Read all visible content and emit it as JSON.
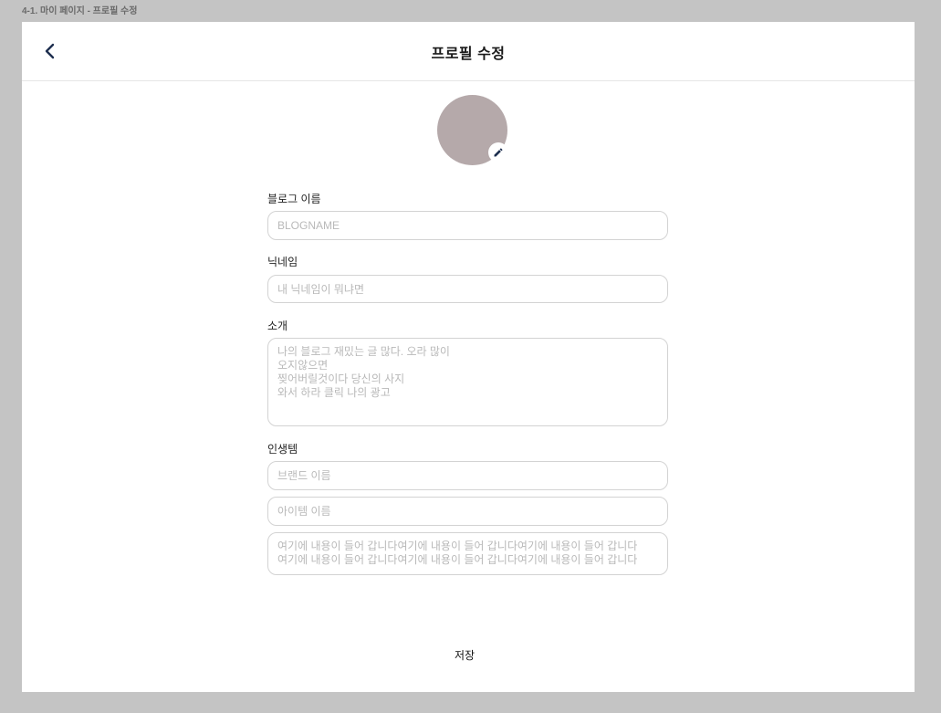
{
  "frame_label": "4-1. 마이 페이지 - 프로필 수정",
  "header": {
    "title": "프로필 수정",
    "back_icon": "chevron-left-icon"
  },
  "avatar": {
    "color": "#b5a9aa",
    "edit_icon": "pencil-icon"
  },
  "form": {
    "blog_name": {
      "label": "블로그 이름",
      "value": "",
      "placeholder": "BLOGNAME"
    },
    "nickname": {
      "label": "닉네임",
      "value": "",
      "placeholder": "내 닉네임이 뭐냐면"
    },
    "intro": {
      "label": "소개",
      "value": "",
      "placeholder": "나의 블로그 재밌는 글 많다. 오라 많이\n오지않으면\n찢어버릴것이다 당신의 사지\n와서 하라 클릭 나의 광고"
    },
    "life_item": {
      "label": "인생템",
      "brand": {
        "value": "",
        "placeholder": "브랜드 이름"
      },
      "item": {
        "value": "",
        "placeholder": "아이템 이름"
      },
      "description": {
        "value": "",
        "placeholder": "여기에 내용이 들어 갑니다여기에 내용이 들어 갑니다여기에 내용이 들어 갑니다\n여기에 내용이 들어 갑니다여기에 내용이 들어 갑니다여기에 내용이 들어 갑니다"
      }
    }
  },
  "save_label": "저장"
}
